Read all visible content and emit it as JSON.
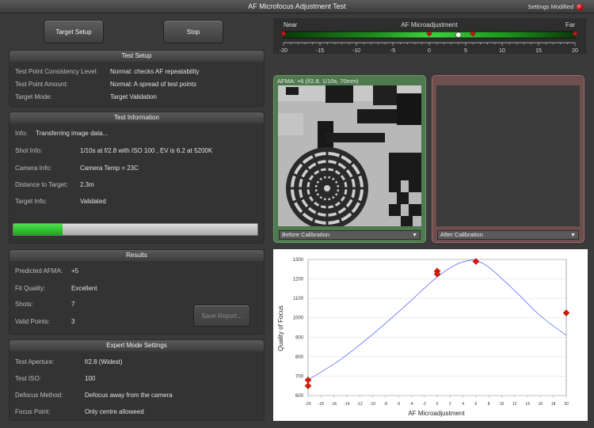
{
  "window": {
    "title": "AF Microfocus Adjustment Test",
    "settings_modified": "Settings Modified"
  },
  "buttons": {
    "target_setup": "Target Setup",
    "stop": "Stop",
    "save_report": "Save Report..."
  },
  "test_setup": {
    "header": "Test Setup",
    "rows": [
      {
        "label": "Test Point Consistency Level:",
        "value": "Normal: checks AF repeatability"
      },
      {
        "label": "Test Point Amount:",
        "value": "Normal: A spread of test points"
      },
      {
        "label": "Target Mode:",
        "value": "Target Validation"
      }
    ]
  },
  "test_info": {
    "header": "Test Information",
    "info_label": "Info:",
    "info_value": "Transferring image data...",
    "rows": [
      {
        "label": "Shot Info:",
        "value": "1/10s at f/2.8 with ISO 100 , EV is 6.2 at 5200K"
      },
      {
        "label": "Camera Info:",
        "value": "Camera Temp = 23C"
      },
      {
        "label": "Distance to Target:",
        "value": "2.3m"
      },
      {
        "label": "Target Info:",
        "value": "Validated"
      }
    ],
    "progress": 0.2
  },
  "results": {
    "header": "Results",
    "rows": [
      {
        "label": "Predicted AFMA:",
        "value": "+5"
      },
      {
        "label": "Fit Quality:",
        "value": "Excellent"
      },
      {
        "label": "Shots:",
        "value": "7"
      },
      {
        "label": "Valid Points:",
        "value": "3"
      }
    ]
  },
  "expert": {
    "header": "Expert Mode Settings",
    "rows": [
      {
        "label": "Test Aperture:",
        "value": "f/2.8 (Widest)"
      },
      {
        "label": "Test ISO:",
        "value": "100"
      },
      {
        "label": "Defocus Method:",
        "value": "Defocus away from the camera"
      },
      {
        "label": "Focus Point:",
        "value": "Only centre alloweed"
      }
    ]
  },
  "slider": {
    "near": "Near",
    "far": "Far",
    "title": "AF Microadjustment",
    "ticks": [
      "-20",
      "-15",
      "-10",
      "-5",
      "0",
      "5",
      "10",
      "15",
      "20"
    ],
    "min": -20,
    "max": 20,
    "current": 4,
    "markers": [
      -20,
      0,
      6,
      20
    ]
  },
  "preview": {
    "before_caption": "AFMA: +6 (f/2.8, 1/10s, 70mm)",
    "before_select": "Before Calibration",
    "after_select": "After Calibration"
  },
  "chart_data": {
    "type": "scatter",
    "xlabel": "AF Microadjustment",
    "ylabel": "Quality of Focus",
    "xlim": [
      -20,
      20
    ],
    "ylim": [
      600,
      1300
    ],
    "x_ticks": [
      -20,
      -18,
      -16,
      -14,
      -12,
      -10,
      -8,
      -6,
      -4,
      -2,
      0,
      2,
      4,
      6,
      8,
      10,
      12,
      14,
      16,
      18,
      20
    ],
    "y_ticks": [
      600,
      700,
      800,
      900,
      1000,
      1100,
      1200,
      1300
    ],
    "points": [
      {
        "x": -20,
        "y": 680
      },
      {
        "x": -20,
        "y": 650
      },
      {
        "x": 0,
        "y": 1240
      },
      {
        "x": 0,
        "y": 1225
      },
      {
        "x": 6,
        "y": 1290
      },
      {
        "x": 6,
        "y": 1290
      },
      {
        "x": 20,
        "y": 1025
      }
    ],
    "fit_curve": {
      "x": [
        -20,
        -15,
        -10,
        -5,
        0,
        3,
        5,
        6,
        8,
        12,
        16,
        20
      ],
      "y": [
        680,
        785,
        915,
        1060,
        1210,
        1275,
        1295,
        1293,
        1260,
        1140,
        1010,
        910
      ]
    },
    "colors": {
      "curve": "#5a6cff",
      "points": "#dd1a00"
    }
  }
}
